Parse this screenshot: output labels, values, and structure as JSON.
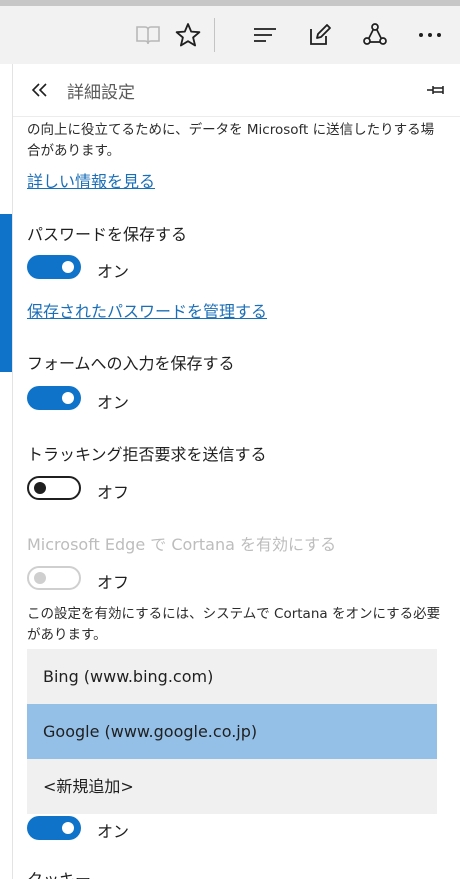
{
  "browser": {
    "icons": [
      "reading-view-icon",
      "favorites-star-icon",
      "hub-icon",
      "web-note-icon",
      "share-icon",
      "more-icon"
    ]
  },
  "panel": {
    "title": "詳細設定",
    "intro_text": "の向上に役立てるために、データを Microsoft に送信したりする場合があります。",
    "learn_more_link": "詳しい情報を見る",
    "save_passwords": {
      "label": "パスワードを保存する",
      "state": "オン",
      "on": true
    },
    "manage_passwords_link": "保存されたパスワードを管理する",
    "save_form_entries": {
      "label": "フォームへの入力を保存する",
      "state": "オン",
      "on": true
    },
    "do_not_track": {
      "label": "トラッキング拒否要求を送信する",
      "state": "オフ",
      "on": false
    },
    "cortana": {
      "label": "Microsoft Edge で Cortana を有効にする",
      "state": "オフ",
      "on": false,
      "enabled": false
    },
    "cortana_note": "この設定を有効にするには、システムで Cortana をオンにする必要があります。",
    "search_provider_dropdown": {
      "options": [
        "Bing (www.bing.com)",
        "Google (www.google.co.jp)",
        "<新規追加>"
      ],
      "selected": "Google (www.google.co.jp)"
    },
    "search_suggestions": {
      "state": "オン",
      "on": true
    },
    "cookies_heading": "クッキー"
  },
  "colors": {
    "accent": "#0f73c9",
    "selected_option": "#94c0e8",
    "link": "#1b6fb8"
  }
}
